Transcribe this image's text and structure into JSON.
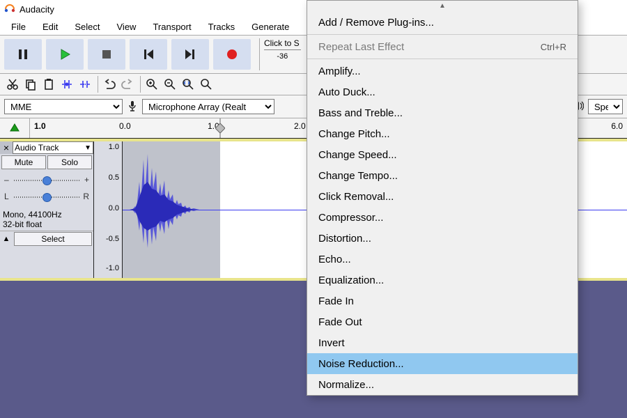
{
  "app": {
    "title": "Audacity"
  },
  "menubar": [
    "File",
    "Edit",
    "Select",
    "View",
    "Transport",
    "Tracks",
    "Generate"
  ],
  "meter": {
    "click_label": "Click to S",
    "scale_mark": "-36"
  },
  "toolbar_icons": {
    "cut": "cut-icon",
    "copy": "copy-icon",
    "paste": "paste-icon",
    "trim": "trim-icon",
    "silence": "silence-icon",
    "undo": "undo-icon",
    "redo": "redo-icon",
    "zoom_in": "zoom-in-icon",
    "zoom_out": "zoom-out-icon",
    "zoom_fit": "zoom-fit-icon",
    "zoom_sel": "zoom-selection-icon"
  },
  "devices": {
    "host": "MME",
    "input": "Microphone Array (Realt",
    "output": "Speak"
  },
  "timeline": {
    "ticks": [
      "1.0",
      "0.0",
      "1.0",
      "2.0",
      "6.0"
    ]
  },
  "track": {
    "name": "Audio Track",
    "mute": "Mute",
    "solo": "Solo",
    "gain_minus": "–",
    "gain_plus": "+",
    "pan_L": "L",
    "pan_R": "R",
    "info_line1": "Mono, 44100Hz",
    "info_line2": "32-bit float",
    "select": "Select",
    "db_ticks": [
      "1.0",
      "0.5",
      "0.0",
      "-0.5",
      "-1.0"
    ]
  },
  "effects_menu": {
    "add_remove": "Add / Remove Plug-ins...",
    "repeat": "Repeat Last Effect",
    "repeat_shortcut": "Ctrl+R",
    "items": [
      "Amplify...",
      "Auto Duck...",
      "Bass and Treble...",
      "Change Pitch...",
      "Change Speed...",
      "Change Tempo...",
      "Click Removal...",
      "Compressor...",
      "Distortion...",
      "Echo...",
      "Equalization...",
      "Fade In",
      "Fade Out",
      "Invert",
      "Noise Reduction...",
      "Normalize..."
    ],
    "highlighted_index": 14
  }
}
